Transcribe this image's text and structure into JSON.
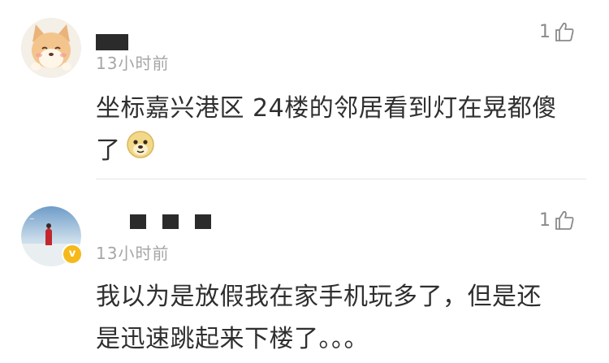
{
  "comments": [
    {
      "time": "13小时前",
      "likes": "1",
      "text_line1": "坐标嘉兴港区 24楼的邻居看到灯在晃都傻",
      "text_line2": "了",
      "emoji": "doge-emoji",
      "verified": false
    },
    {
      "time": "13小时前",
      "likes": "1",
      "text_line1": "我以为是放假我在家手机玩多了，但是还",
      "text_line2": "是迅速跳起来下楼了。。。",
      "verified": true,
      "verified_mark": "v"
    }
  ]
}
